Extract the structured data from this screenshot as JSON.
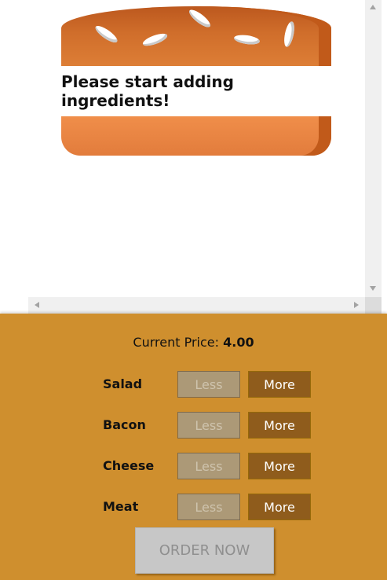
{
  "burger": {
    "message": "Please start adding ingredients!"
  },
  "build_controls": {
    "price_label": "Current Price:",
    "price_value": "4.00",
    "controls": [
      {
        "label": "Salad",
        "less": "Less",
        "more": "More",
        "less_enabled": false
      },
      {
        "label": "Bacon",
        "less": "Less",
        "more": "More",
        "less_enabled": false
      },
      {
        "label": "Cheese",
        "less": "Less",
        "more": "More",
        "less_enabled": false
      },
      {
        "label": "Meat",
        "less": "Less",
        "more": "More",
        "less_enabled": false
      }
    ],
    "order_label": "ORDER NOW",
    "order_enabled": false
  },
  "colors": {
    "controls_background": "#cf8f2e",
    "more_button": "#8f5c1c",
    "less_button_disabled": "#ac9977",
    "bread": "#dd7e36"
  },
  "icons": {
    "scroll_up": "scroll-up-arrow-icon",
    "scroll_down": "scroll-down-arrow-icon",
    "scroll_left": "scroll-left-arrow-icon",
    "scroll_right": "scroll-right-arrow-icon"
  }
}
